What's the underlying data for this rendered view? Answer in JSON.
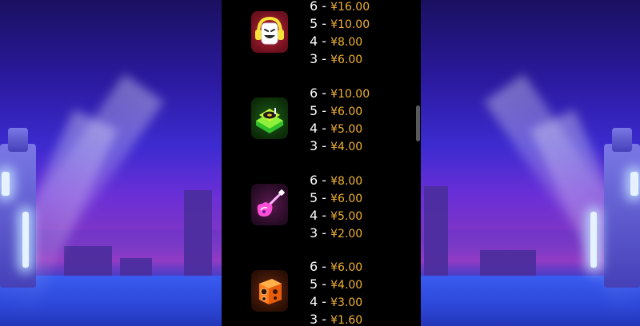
{
  "colors": {
    "count_text": "#ffffff",
    "amount_text": "#f2b233",
    "panel_background": "#000000"
  },
  "symbols": [
    {
      "name": "dj-mask-headphones",
      "icon": "dj-mask-headphones-icon",
      "payouts": [
        {
          "count": "6 - ",
          "amount": "¥16.00"
        },
        {
          "count": "5 - ",
          "amount": "¥10.00"
        },
        {
          "count": "4 - ",
          "amount": "¥8.00"
        },
        {
          "count": "3 - ",
          "amount": "¥6.00"
        }
      ]
    },
    {
      "name": "turntable",
      "icon": "turntable-icon",
      "payouts": [
        {
          "count": "6 - ",
          "amount": "¥10.00"
        },
        {
          "count": "5 - ",
          "amount": "¥6.00"
        },
        {
          "count": "4 - ",
          "amount": "¥5.00"
        },
        {
          "count": "3 - ",
          "amount": "¥4.00"
        }
      ]
    },
    {
      "name": "electric-guitar",
      "icon": "electric-guitar-icon",
      "payouts": [
        {
          "count": "6 - ",
          "amount": "¥8.00"
        },
        {
          "count": "5 - ",
          "amount": "¥6.00"
        },
        {
          "count": "4 - ",
          "amount": "¥5.00"
        },
        {
          "count": "3 - ",
          "amount": "¥2.00"
        }
      ]
    },
    {
      "name": "speaker",
      "icon": "speaker-icon",
      "payouts": [
        {
          "count": "6 - ",
          "amount": "¥6.00"
        },
        {
          "count": "5 - ",
          "amount": "¥4.00"
        },
        {
          "count": "4 - ",
          "amount": "¥3.00"
        },
        {
          "count": "3 - ",
          "amount": "¥1.60"
        }
      ]
    }
  ]
}
